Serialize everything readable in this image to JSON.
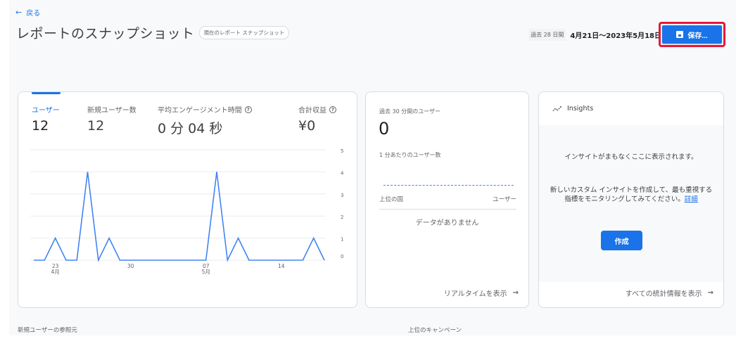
{
  "header": {
    "back_icon": "arrow-left-icon",
    "back_label": "戻る",
    "title": "レポートのスナップショット",
    "title_chip": "現在のレポート スナップショット",
    "date_chip": "過去 28 日間",
    "date_range": "4月21日～2023年5月18日",
    "save_icon": "save-icon",
    "save_label": "保存..."
  },
  "overview_card": {
    "metrics": [
      {
        "label": "ユーザー",
        "value": "12",
        "help": false,
        "active": true
      },
      {
        "label": "新規ユーザー数",
        "value": "12",
        "help": false,
        "active": false
      },
      {
        "label": "平均エンゲージメント時間",
        "value": "0 分 04 秒",
        "help": true,
        "active": false
      },
      {
        "label": "合計収益",
        "value": "¥0",
        "help": true,
        "active": false
      }
    ],
    "help_glyph": "?"
  },
  "chart_data": {
    "type": "line",
    "title": "",
    "xlabel": "",
    "ylabel": "",
    "x": [
      "4/21",
      "4/22",
      "4/23",
      "4/24",
      "4/25",
      "4/26",
      "4/27",
      "4/28",
      "4/29",
      "4/30",
      "5/1",
      "5/2",
      "5/3",
      "5/4",
      "5/5",
      "5/6",
      "5/7",
      "5/8",
      "5/9",
      "5/10",
      "5/11",
      "5/12",
      "5/13",
      "5/14",
      "5/15",
      "5/16",
      "5/17",
      "5/18"
    ],
    "series": [
      {
        "name": "ユーザー",
        "color": "#4285f4",
        "values": [
          0,
          0,
          1,
          0,
          0,
          4,
          0,
          1,
          0,
          0,
          0,
          0,
          0,
          0,
          0,
          0,
          0,
          4,
          0,
          1,
          0,
          0,
          0,
          0,
          0,
          0,
          1,
          0
        ]
      }
    ],
    "ylim": [
      0,
      5
    ],
    "y_ticks": [
      "0",
      "1",
      "2",
      "3",
      "4",
      "5"
    ],
    "y_axis_side": "right",
    "x_ticks": [
      {
        "index": 2,
        "day": "23",
        "month": "4月"
      },
      {
        "index": 9,
        "day": "30",
        "month": ""
      },
      {
        "index": 16,
        "day": "07",
        "month": "5月"
      },
      {
        "index": 23,
        "day": "14",
        "month": ""
      }
    ],
    "grid": true,
    "legend": "none"
  },
  "realtime_card": {
    "label": "過去 30 分間のユーザー",
    "value": "0",
    "per_minute_label": "1 分あたりのユーザー数",
    "table_col_country": "上位の国",
    "table_col_users": "ユーザー",
    "no_data": "データがありません",
    "link_label": "リアルタイムを表示",
    "link_icon": "arrow-right-icon"
  },
  "insights_card": {
    "icon": "insights-icon",
    "title": "Insights",
    "message1": "インサイトがまもなくここに表示されます。",
    "message2": "新しいカスタム インサイトを作成して、最も重視する指標をモニタリングしてみてください。",
    "learn_more": "詳細",
    "create_label": "作成",
    "link_label": "すべての統計情報を表示",
    "link_icon": "arrow-right-icon"
  },
  "sections": {
    "new_user_source": "新規ユーザーの参照元",
    "top_campaigns": "上位のキャンペーン"
  },
  "colors": {
    "accent": "#1a73e8",
    "line": "#4285f4",
    "highlight_border": "#e8173b"
  }
}
